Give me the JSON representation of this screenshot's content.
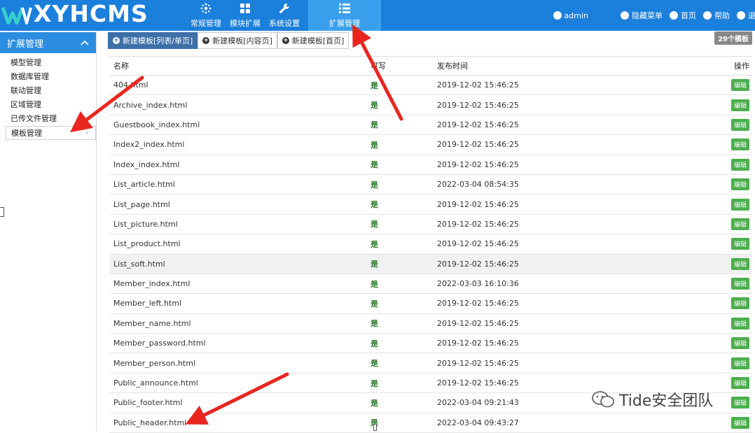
{
  "app": {
    "logo_text": "XYHCMS"
  },
  "nav": {
    "items": [
      {
        "label": "常规管理",
        "icon": "settings-cluster-icon"
      },
      {
        "label": "模块扩展",
        "icon": "grid-icon"
      },
      {
        "label": "系统设置",
        "icon": "wrench-icon"
      },
      {
        "label": "扩展管理",
        "icon": "list-icon",
        "active": true
      }
    ]
  },
  "top_right": {
    "user": "admin",
    "hide_menu": "隐藏菜单",
    "home": "首页",
    "help": "帮助",
    "logout": "退出"
  },
  "sidebar": {
    "title": "扩展管理",
    "items": [
      {
        "label": "模型管理"
      },
      {
        "label": "数据库管理"
      },
      {
        "label": "联动管理"
      },
      {
        "label": "区域管理"
      },
      {
        "label": "已传文件管理"
      },
      {
        "label": "模板管理",
        "active": true
      }
    ]
  },
  "main": {
    "tabs": [
      {
        "label": "新建模板[列表/单页]",
        "active": true
      },
      {
        "label": "新建模板[内容页]"
      },
      {
        "label": "新建模板[首页]"
      }
    ],
    "count_badge": "29个模板",
    "table": {
      "headers": {
        "name": "名称",
        "writable": "可写",
        "time": "发布时间",
        "ops": "操作"
      },
      "edit_label": "编辑",
      "rows": [
        {
          "name": "404.html",
          "writable": "是",
          "time": "2019-12-02 15:46:25"
        },
        {
          "name": "Archive_index.html",
          "writable": "是",
          "time": "2019-12-02 15:46:25"
        },
        {
          "name": "Guestbook_index.html",
          "writable": "是",
          "time": "2019-12-02 15:46:25"
        },
        {
          "name": "Index2_index.html",
          "writable": "是",
          "time": "2019-12-02 15:46:25"
        },
        {
          "name": "Index_index.html",
          "writable": "是",
          "time": "2019-12-02 15:46:25"
        },
        {
          "name": "List_article.html",
          "writable": "是",
          "time": "2022-03-04 08:54:35"
        },
        {
          "name": "List_page.html",
          "writable": "是",
          "time": "2019-12-02 15:46:25"
        },
        {
          "name": "List_picture.html",
          "writable": "是",
          "time": "2019-12-02 15:46:25"
        },
        {
          "name": "List_product.html",
          "writable": "是",
          "time": "2019-12-02 15:46:25"
        },
        {
          "name": "List_soft.html",
          "writable": "是",
          "time": "2019-12-02 15:46:25",
          "highlight": true
        },
        {
          "name": "Member_index.html",
          "writable": "是",
          "time": "2022-03-03 16:10:36"
        },
        {
          "name": "Member_left.html",
          "writable": "是",
          "time": "2019-12-02 15:46:25"
        },
        {
          "name": "Member_name.html",
          "writable": "是",
          "time": "2019-12-02 15:46:25"
        },
        {
          "name": "Member_password.html",
          "writable": "是",
          "time": "2019-12-02 15:46:25"
        },
        {
          "name": "Member_person.html",
          "writable": "是",
          "time": "2019-12-02 15:46:25"
        },
        {
          "name": "Public_announce.html",
          "writable": "是",
          "time": "2019-12-02 15:46:25"
        },
        {
          "name": "Public_footer.html",
          "writable": "是",
          "time": "2022-03-04 09:21:43"
        },
        {
          "name": "Public_header.html",
          "writable": "是",
          "time": "2022-03-04 09:43:27"
        }
      ]
    }
  },
  "watermark": {
    "text": "Tide安全团队"
  },
  "colors": {
    "topbar": "#1b7fdc",
    "active_nav": "#3aa0ee",
    "sidebar_head": "#2b8de0",
    "tab_active": "#3d6fa8",
    "edit_button": "#4cae4c",
    "yes_text": "#2d7d2d",
    "annotation_arrow": "#e8261f"
  }
}
